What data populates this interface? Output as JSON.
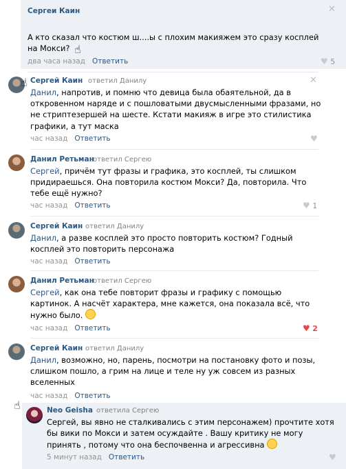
{
  "reply_label": "Ответить",
  "replied_to_dan": "ответил Данилу",
  "replied_to_serg": "ответил Сергею",
  "replied_to_serg_f": "ответила Сергею",
  "comments": [
    {
      "author": "Сергеи Каин",
      "text": "А кто сказал что костюм ш....ы с плохим макияжем это сразу косплей на Мокси?",
      "time": "два часа назад",
      "likes": "5"
    },
    {
      "author": "Сергей Каин",
      "addressee": "Данил",
      "text": ", напротив, и помню что девица была обаятельной, да в откровенном наряде и с пошловатыми двусмысленными фразами, но не стриптезершей на шесте. Кстати макияж в игре это стилистика графики, а тут маска",
      "time": "час назад",
      "likes": ""
    },
    {
      "author": "Данил Ретьман",
      "addressee": "Сергей",
      "text": ", причём тут фразы и графика, это косплей, ты слишком придираешься. Она повторила костюм Мокси? Да, повторила. Что тебе ещё нужно?",
      "time": "час назад",
      "likes": "1"
    },
    {
      "author": "Сергей Каин",
      "addressee": "Данил",
      "text": ", а разве косплей это просто повторить костюм? Годный косплей это повторить персонажа",
      "time": "час назад",
      "likes": ""
    },
    {
      "author": "Данил Ретьман",
      "addressee": "Сергей",
      "text": ", как она тебе повторит фразы и графику с помощью картинок. А насчёт характера, мне кажется, она показала всё, что нужно было.",
      "time": "час назад",
      "likes": "2"
    },
    {
      "author": "Сергей Каин",
      "addressee": "Данил",
      "text": ", возможно, но, парень, посмотри на постановку фото и позы, слишком пошло, а грим на лице и теле ну уж совсем из разных вселенных",
      "time": "час назад",
      "likes": ""
    },
    {
      "author": "Neo Geisha",
      "addressee": "",
      "text": "Сергей, вы явно не сталкивались с этим персонажем) прочтите хотя бы вики по Мокси и затем осуждайте . Вашу критику не могу принять , потому что она беспочвенна и агрессивна",
      "time": "5 минут назад",
      "likes": ""
    }
  ]
}
